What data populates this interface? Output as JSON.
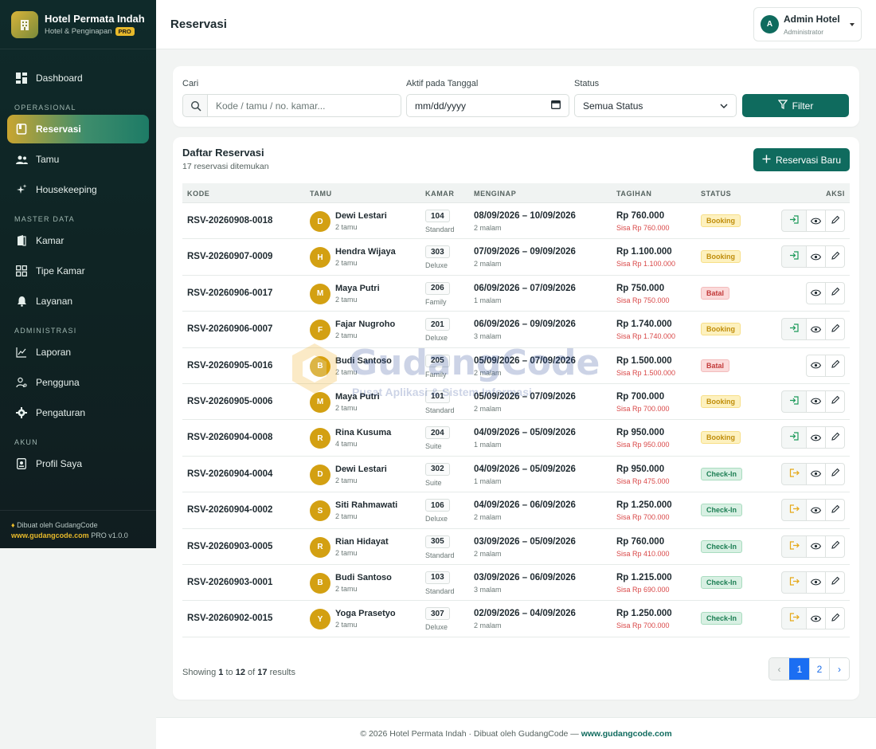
{
  "brand": {
    "title": "Hotel Permata Indah",
    "subtitle": "Hotel & Penginapan",
    "badge": "PRO"
  },
  "nav": {
    "dashboard": "Dashboard",
    "section_operasional": "OPERASIONAL",
    "reservasi": "Reservasi",
    "tamu": "Tamu",
    "housekeeping": "Housekeeping",
    "section_master": "MASTER DATA",
    "kamar": "Kamar",
    "tipe_kamar": "Tipe Kamar",
    "layanan": "Layanan",
    "section_admin": "ADMINISTRASI",
    "laporan": "Laporan",
    "pengguna": "Pengguna",
    "pengaturan": "Pengaturan",
    "section_akun": "AKUN",
    "profil": "Profil Saya"
  },
  "sidebar_footer": {
    "line1": "Dibuat oleh GudangCode",
    "link": "www.gudangcode.com",
    "version": "PRO v1.0.0"
  },
  "header": {
    "title": "Reservasi",
    "user_initial": "A",
    "user_name": "Admin Hotel",
    "user_role": "Administrator"
  },
  "filters": {
    "search_label": "Cari",
    "search_placeholder": "Kode / tamu / no. kamar...",
    "date_label": "Aktif pada Tanggal",
    "date_placeholder": "mm/dd/yyyy",
    "status_label": "Status",
    "status_value": "Semua Status",
    "filter_button": "Filter"
  },
  "list": {
    "title": "Daftar Reservasi",
    "subtitle": "17 reservasi ditemukan",
    "new_button": "Reservasi Baru",
    "columns": {
      "kode": "KODE",
      "tamu": "TAMU",
      "kamar": "KAMAR",
      "menginap": "MENGINAP",
      "tagihan": "TAGIHAN",
      "status": "STATUS",
      "aksi": "AKSI"
    },
    "rows": [
      {
        "kode": "RSV-20260908-0018",
        "initial": "D",
        "name": "Dewi Lestari",
        "guests": "2 tamu",
        "room": "104",
        "type": "Standard",
        "dates": "08/09/2026 – 10/09/2026",
        "nights": "2 malam",
        "bill": "Rp 760.000",
        "rem": "Sisa Rp 760.000",
        "status": "Booking",
        "stype": "booking",
        "action": "checkin"
      },
      {
        "kode": "RSV-20260907-0009",
        "initial": "H",
        "name": "Hendra Wijaya",
        "guests": "2 tamu",
        "room": "303",
        "type": "Deluxe",
        "dates": "07/09/2026 – 09/09/2026",
        "nights": "2 malam",
        "bill": "Rp 1.100.000",
        "rem": "Sisa Rp 1.100.000",
        "status": "Booking",
        "stype": "booking",
        "action": "checkin"
      },
      {
        "kode": "RSV-20260906-0017",
        "initial": "M",
        "name": "Maya Putri",
        "guests": "2 tamu",
        "room": "206",
        "type": "Family",
        "dates": "06/09/2026 – 07/09/2026",
        "nights": "1 malam",
        "bill": "Rp 750.000",
        "rem": "Sisa Rp 750.000",
        "status": "Batal",
        "stype": "batal",
        "action": "none"
      },
      {
        "kode": "RSV-20260906-0007",
        "initial": "F",
        "name": "Fajar Nugroho",
        "guests": "2 tamu",
        "room": "201",
        "type": "Deluxe",
        "dates": "06/09/2026 – 09/09/2026",
        "nights": "3 malam",
        "bill": "Rp 1.740.000",
        "rem": "Sisa Rp 1.740.000",
        "status": "Booking",
        "stype": "booking",
        "action": "checkin"
      },
      {
        "kode": "RSV-20260905-0016",
        "initial": "B",
        "name": "Budi Santoso",
        "guests": "2 tamu",
        "room": "205",
        "type": "Family",
        "dates": "05/09/2026 – 07/09/2026",
        "nights": "2 malam",
        "bill": "Rp 1.500.000",
        "rem": "Sisa Rp 1.500.000",
        "status": "Batal",
        "stype": "batal",
        "action": "none"
      },
      {
        "kode": "RSV-20260905-0006",
        "initial": "M",
        "name": "Maya Putri",
        "guests": "2 tamu",
        "room": "101",
        "type": "Standard",
        "dates": "05/09/2026 – 07/09/2026",
        "nights": "2 malam",
        "bill": "Rp 700.000",
        "rem": "Sisa Rp 700.000",
        "status": "Booking",
        "stype": "booking",
        "action": "checkin"
      },
      {
        "kode": "RSV-20260904-0008",
        "initial": "R",
        "name": "Rina Kusuma",
        "guests": "4 tamu",
        "room": "204",
        "type": "Suite",
        "dates": "04/09/2026 – 05/09/2026",
        "nights": "1 malam",
        "bill": "Rp 950.000",
        "rem": "Sisa Rp 950.000",
        "status": "Booking",
        "stype": "booking",
        "action": "checkin"
      },
      {
        "kode": "RSV-20260904-0004",
        "initial": "D",
        "name": "Dewi Lestari",
        "guests": "2 tamu",
        "room": "302",
        "type": "Suite",
        "dates": "04/09/2026 – 05/09/2026",
        "nights": "1 malam",
        "bill": "Rp 950.000",
        "rem": "Sisa Rp 475.000",
        "status": "Check-In",
        "stype": "checkin",
        "action": "checkout"
      },
      {
        "kode": "RSV-20260904-0002",
        "initial": "S",
        "name": "Siti Rahmawati",
        "guests": "2 tamu",
        "room": "106",
        "type": "Deluxe",
        "dates": "04/09/2026 – 06/09/2026",
        "nights": "2 malam",
        "bill": "Rp 1.250.000",
        "rem": "Sisa Rp 700.000",
        "status": "Check-In",
        "stype": "checkin",
        "action": "checkout"
      },
      {
        "kode": "RSV-20260903-0005",
        "initial": "R",
        "name": "Rian Hidayat",
        "guests": "2 tamu",
        "room": "305",
        "type": "Standard",
        "dates": "03/09/2026 – 05/09/2026",
        "nights": "2 malam",
        "bill": "Rp 760.000",
        "rem": "Sisa Rp 410.000",
        "status": "Check-In",
        "stype": "checkin",
        "action": "checkout"
      },
      {
        "kode": "RSV-20260903-0001",
        "initial": "B",
        "name": "Budi Santoso",
        "guests": "2 tamu",
        "room": "103",
        "type": "Standard",
        "dates": "03/09/2026 – 06/09/2026",
        "nights": "3 malam",
        "bill": "Rp 1.215.000",
        "rem": "Sisa Rp 690.000",
        "status": "Check-In",
        "stype": "checkin",
        "action": "checkout"
      },
      {
        "kode": "RSV-20260902-0015",
        "initial": "Y",
        "name": "Yoga Prasetyo",
        "guests": "2 tamu",
        "room": "307",
        "type": "Deluxe",
        "dates": "02/09/2026 – 04/09/2026",
        "nights": "2 malam",
        "bill": "Rp 1.250.000",
        "rem": "Sisa Rp 700.000",
        "status": "Check-In",
        "stype": "checkin",
        "action": "checkout"
      }
    ]
  },
  "pagination": {
    "showing_prefix": "Showing",
    "from": "1",
    "to_word": "to",
    "to": "12",
    "of_word": "of",
    "total": "17",
    "results_word": "results",
    "prev": "‹",
    "page1": "1",
    "page2": "2",
    "next": "›"
  },
  "footer": {
    "text": "© 2026 Hotel Permata Indah · Dibuat oleh GudangCode — ",
    "link": "www.gudangcode.com"
  },
  "watermark": {
    "text": "GudangCode",
    "sub": "Pusat Aplikasi & Sistem Informasi"
  },
  "colors": {
    "primary": "#0f6b5e",
    "accent": "#e7b92a",
    "sidebar": "#0f2a2a",
    "danger": "#d94848"
  },
  "icons": {
    "search": "search-icon",
    "filter": "funnel-icon",
    "plus": "plus-icon",
    "checkin": "login-icon",
    "checkout": "logout-icon",
    "view": "eye-icon",
    "edit": "pencil-icon"
  }
}
